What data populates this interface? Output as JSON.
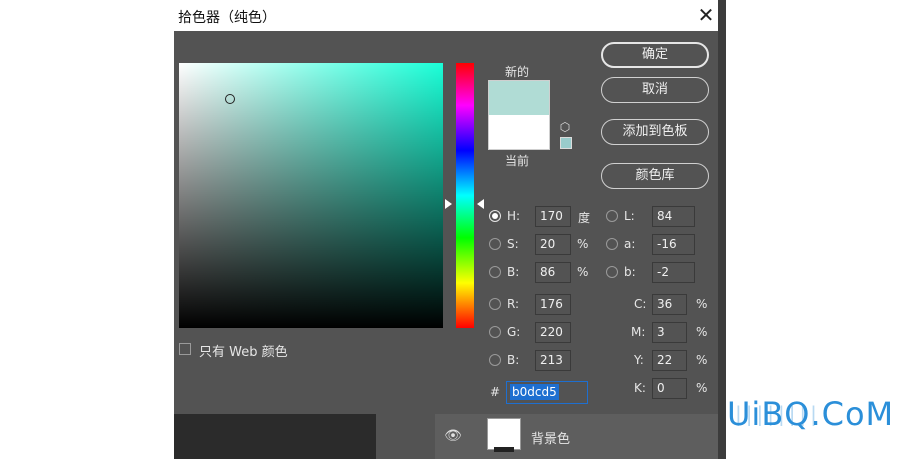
{
  "dialog": {
    "title": "拾色器（纯色）",
    "close_glyph": "✕",
    "new_label": "新的",
    "current_label": "当前",
    "new_color": "#b0dcd5",
    "current_color": "#ffffff",
    "hue_color": "#1affd8"
  },
  "buttons": {
    "ok": "确定",
    "cancel": "取消",
    "add_to_swatches": "添加到色板",
    "color_libraries": "颜色库"
  },
  "hsb": {
    "h_label": "H:",
    "h_value": "170",
    "h_unit": "度",
    "s_label": "S:",
    "s_value": "20",
    "s_unit": "%",
    "b_label": "B:",
    "b_value": "86",
    "b_unit": "%"
  },
  "rgb": {
    "r_label": "R:",
    "r_value": "176",
    "g_label": "G:",
    "g_value": "220",
    "b_label": "B:",
    "b_value": "213"
  },
  "lab": {
    "l_label": "L:",
    "l_value": "84",
    "a_label": "a:",
    "a_value": "-16",
    "b_label": "b:",
    "b_value": "-2"
  },
  "cmyk": {
    "c_label": "C:",
    "c_value": "36",
    "c_unit": "%",
    "m_label": "M:",
    "m_value": "3",
    "m_unit": "%",
    "y_label": "Y:",
    "y_value": "22",
    "y_unit": "%",
    "k_label": "K:",
    "k_value": "0",
    "k_unit": "%"
  },
  "hex": {
    "hash": "#",
    "value": "b0dcd5"
  },
  "web_only_label": "只有 Web 颜色",
  "layers": {
    "eye_glyph": "👁",
    "layer_name": "背景色"
  },
  "watermark": {
    "logo": "UiBQ.CoM",
    "lines": "||||||||"
  }
}
